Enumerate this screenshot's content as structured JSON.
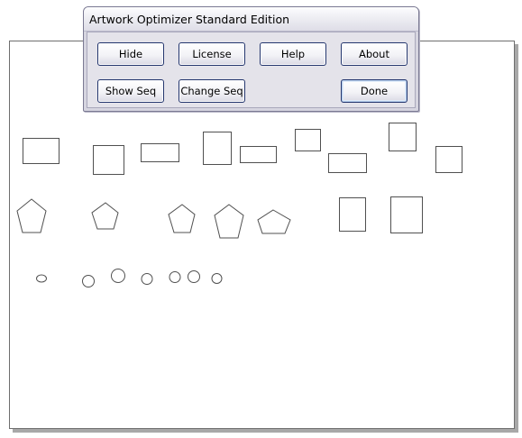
{
  "dialog": {
    "title": "Artwork Optimizer Standard Edition",
    "buttons": {
      "hide": "Hide",
      "license": "License",
      "help": "Help",
      "about": "About",
      "show_seq": "Show Seq",
      "change_seq": "Change Seq",
      "done": "Done"
    }
  },
  "colors": {
    "shape_stroke": "#505050",
    "page_border": "#6e6e6e",
    "button_border": "#24366e"
  }
}
